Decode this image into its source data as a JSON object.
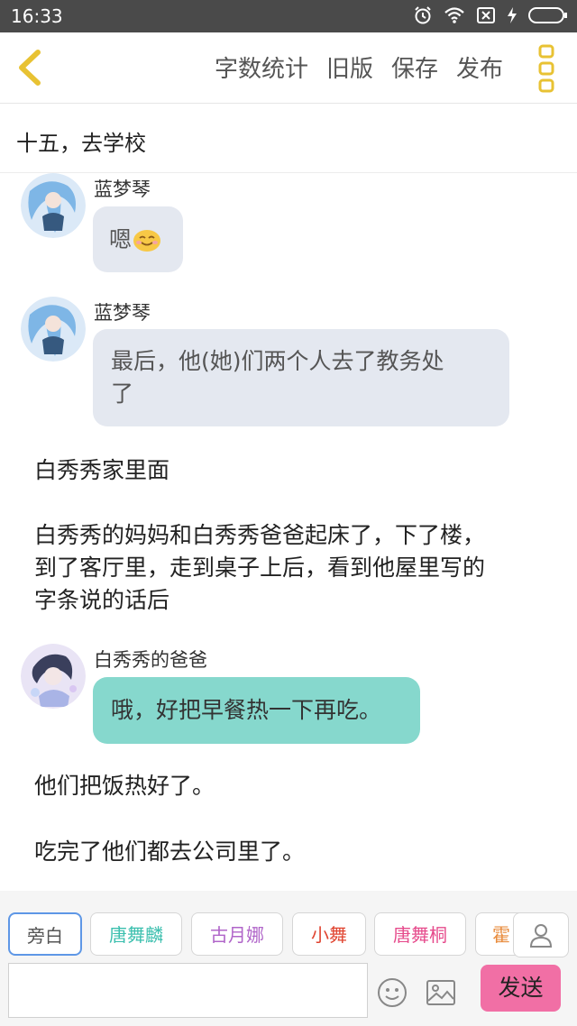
{
  "status_bar": {
    "time": "16:33",
    "icons": [
      "alarm-icon",
      "wifi-icon",
      "sim-none-icon",
      "charging-icon",
      "battery-icon"
    ]
  },
  "toolbar": {
    "back_icon": "chevron-left-icon",
    "word_count": "字数统计",
    "old_version": "旧版",
    "save": "保存",
    "publish": "发布",
    "more_icon": "more-vertical-icon",
    "accent_color": "#e8c233"
  },
  "chapter": {
    "title": "十五，去学校"
  },
  "messages": [
    {
      "type": "dialog",
      "sender": "蓝梦琴",
      "text": "嗯",
      "emoji": "smile-emoji",
      "bubble_color": "#e4e8f0"
    },
    {
      "type": "dialog",
      "sender": "蓝梦琴",
      "lines": [
        "最后，他(她)们两个人去了教务处",
        "了"
      ],
      "bubble_color": "#e4e8f0"
    },
    {
      "type": "narration",
      "text": "白秀秀家里面"
    },
    {
      "type": "narration",
      "lines": [
        "白秀秀的妈妈和白秀秀爸爸起床了，下了楼，",
        "到了客厅里，走到桌子上后，看到他屋里写的",
        "字条说的话后"
      ]
    },
    {
      "type": "dialog",
      "sender": "白秀秀的爸爸",
      "text": "哦，好把早餐热一下再吃。",
      "bubble_color": "#86d8cd"
    },
    {
      "type": "narration",
      "text": "他们把饭热好了。"
    },
    {
      "type": "narration",
      "text": "吃完了他们都去公司里了。"
    }
  ],
  "role_chips": [
    {
      "label": "旁白",
      "color": "#555555",
      "selected": true
    },
    {
      "label": "唐舞麟",
      "color": "#3bbfae",
      "selected": false
    },
    {
      "label": "古月娜",
      "color": "#b065c9",
      "selected": false
    },
    {
      "label": "小舞",
      "color": "#e0432f",
      "selected": false
    },
    {
      "label": "唐舞桐",
      "color": "#e64b8c",
      "selected": false
    },
    {
      "label": "霍",
      "color": "#e88a3a",
      "selected": false
    }
  ],
  "composer": {
    "input_value": "",
    "person_icon": "person-icon",
    "emoji_icon": "emoji-icon",
    "image_icon": "image-icon",
    "send_label": "发送",
    "send_color": "#f16fa5"
  }
}
